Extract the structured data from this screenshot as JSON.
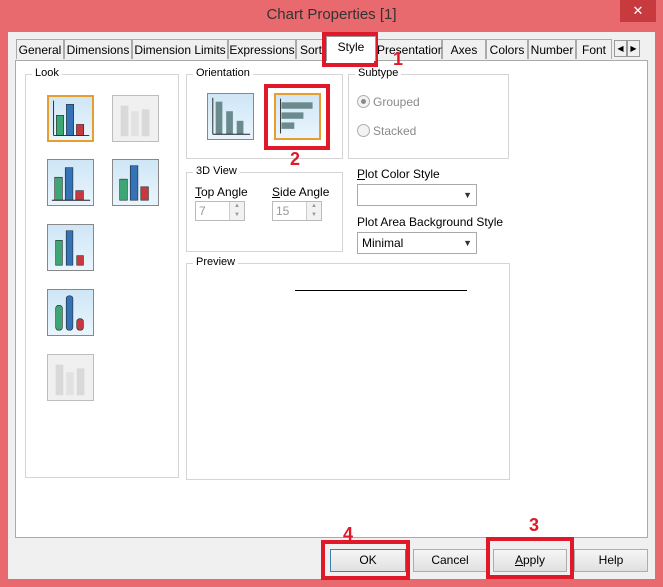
{
  "window": {
    "title": "Chart Properties [1]",
    "close_glyph": "✕"
  },
  "tabs": [
    "General",
    "Dimensions",
    "Dimension Limits",
    "Expressions",
    "Sort",
    "Style",
    "Presentation",
    "Axes",
    "Colors",
    "Number",
    "Font"
  ],
  "active_tab": "Style",
  "groups": {
    "look": "Look",
    "orientation": "Orientation",
    "subtype": "Subtype",
    "view3d": "3D View",
    "preview": "Preview"
  },
  "subtype": {
    "grouped": "Grouped",
    "stacked": "Stacked"
  },
  "view3d": {
    "top_prefix": "T",
    "top_rest": "op Angle",
    "top_value": "7",
    "side_prefix": "S",
    "side_rest": "ide Angle",
    "side_value": "15"
  },
  "plot_color_style": {
    "prefix": "P",
    "rest": "lot Color Style",
    "value": ""
  },
  "plot_area_bg": {
    "label": "Plot Area Background Style",
    "value": "Minimal"
  },
  "buttons": {
    "ok": "OK",
    "cancel": "Cancel",
    "apply_prefix": "A",
    "apply_rest": "pply",
    "help": "Help"
  },
  "annotations": [
    "1",
    "2",
    "3",
    "4"
  ],
  "colors": {
    "annotation": "#e0192a",
    "title_bar": "#e8696e"
  },
  "icons": {
    "tab_left": "◀",
    "tab_right": "▶",
    "spin_up": "▲",
    "spin_down": "▼",
    "dropdown": "▼"
  }
}
